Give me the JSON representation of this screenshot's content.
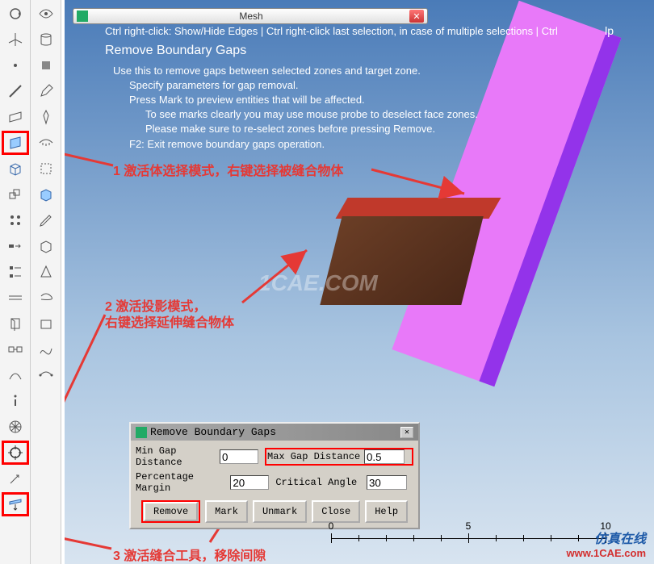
{
  "window": {
    "title": "Mesh",
    "help": "lp"
  },
  "hint_line": "Ctrl right-click: Show/Hide Edges | Ctrl right-click last selection, in case of multiple selections | Ctrl",
  "instructions": {
    "title": "Remove Boundary Gaps",
    "lines": [
      "Use this to remove gaps between selected zones and target zone.",
      "Specify parameters for gap removal.",
      "Press Mark to preview entities that will be affected.",
      "To see marks clearly you may use mouse probe to deselect face zones.",
      "Please make sure to re-select zones before pressing Remove.",
      "F2: Exit remove boundary gaps operation."
    ]
  },
  "annotations": {
    "a1": "1 激活体选择模式，右键选择被缝合物体",
    "a2a": "2 激活投影模式，",
    "a2b": "右键选择延伸缝合物体",
    "a3": "3 激活缝合工具，移除间隙"
  },
  "watermark": "1CAE.COM",
  "dialog": {
    "title": "Remove Boundary Gaps",
    "fields": {
      "min_gap_label": "Min Gap Distance",
      "min_gap_value": "0",
      "max_gap_label": "Max Gap Distance",
      "max_gap_value": "0.5",
      "pct_label": "Percentage Margin",
      "pct_value": "20",
      "crit_label": "Critical Angle",
      "crit_value": "30"
    },
    "buttons": {
      "remove": "Remove",
      "mark": "Mark",
      "unmark": "Unmark",
      "close": "Close",
      "help": "Help"
    }
  },
  "ruler": {
    "t0": "0",
    "t5": "5",
    "t10": "10"
  },
  "footer": {
    "cn": "仿真在线",
    "url": "www.1CAE.com"
  },
  "icons": {
    "col1": [
      "rotate",
      "axis",
      "point",
      "line",
      "plane",
      "face",
      "body",
      "bodies",
      "group",
      "move",
      "align",
      "grid",
      "section",
      "measure",
      "info",
      "mesh",
      "target",
      "probe",
      "project"
    ],
    "col2": [
      "eye",
      "cylinder",
      "obj",
      "pen",
      "pen2",
      "eye2",
      "sel",
      "cube",
      "pencil",
      "cube2",
      "cone",
      "wrap",
      "box",
      "spline",
      "curve"
    ]
  }
}
